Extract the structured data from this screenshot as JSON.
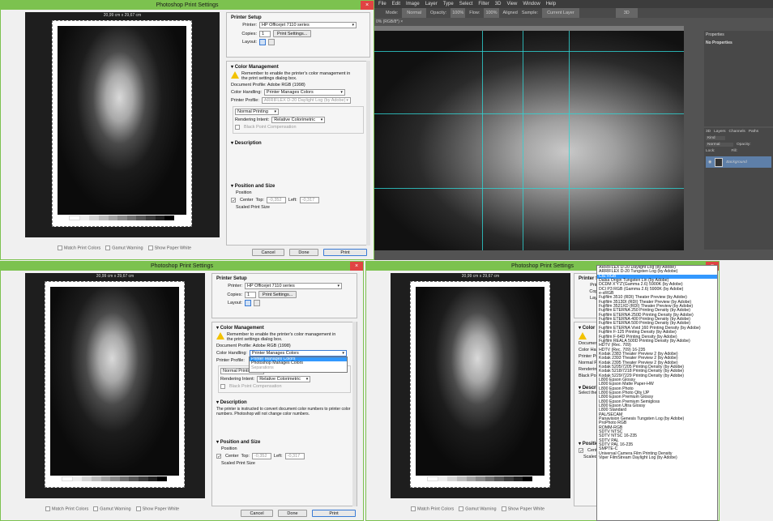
{
  "ps_app": {
    "logo": "Ps",
    "menu": [
      "File",
      "Edit",
      "Image",
      "Layer",
      "Type",
      "Select",
      "Filter",
      "3D",
      "View",
      "Window",
      "Help"
    ],
    "options": {
      "mode_label": "Mode:",
      "mode_value": "Normal",
      "opacity_label": "Opacity:",
      "opacity_value": "100%",
      "flow_label": "Flow:",
      "flow_value": "100%",
      "aligned_label": "Aligned",
      "sample_label": "Sample:",
      "sample_value": "Current Layer",
      "workspace": "3D"
    },
    "doc_tab": "0% (RGB/8*) ×",
    "properties_title": "Properties",
    "no_properties": "No Properties",
    "layer_tabs": [
      "3D",
      "Layers",
      "Channels",
      "Paths"
    ],
    "layer_kind": "Kind",
    "blend_mode": "Normal",
    "opacity_label": "Opacity:",
    "lock_label": "Lock:",
    "fill_label": "Fill:",
    "layer_name": "Background"
  },
  "dialog": {
    "title": "Photoshop Print Settings",
    "close": "×",
    "paper_size": "20,99 cm x 29,67 cm",
    "swatch_labels": [
      "0%",
      "10%",
      "20%",
      "30%",
      "40%",
      "50%",
      "60%",
      "70%",
      "80%",
      "90%",
      "100%"
    ],
    "match_print_colors": "Match Print Colors",
    "gamut_warning": "Gamut Warning",
    "show_paper_white": "Show Paper White",
    "printer_setup": "Printer Setup",
    "printer_label": "Printer:",
    "printer_value": "HP Officejet 7110 series",
    "copies_label": "Copies:",
    "copies_value": "1",
    "print_settings_btn": "Print Settings...",
    "layout_label": "Layout:",
    "color_management": "Color Management",
    "cm_note": "Remember to enable the printer's color management in the print settings dialog box.",
    "document_profile": "Document Profile: Adobe RGB (1998)",
    "color_handling_label": "Color Handling:",
    "color_handling_value": "Printer Manages Colors",
    "printer_profile_label": "Printer Profile:",
    "printer_profile_value": "ARRIFLEX D-20 Daylight Log (by Adobe)",
    "normal_printing": "Normal Printing",
    "rendering_intent_label": "Rendering Intent:",
    "rendering_intent_value": "Relative Colorimetric",
    "black_point": "Black Point Compensation",
    "description": "Description",
    "description_text": "The printer is instructed to convert document color numbers to printer color numbers. Photoshop will not change color numbers.",
    "description_text_short": "Select the profile a",
    "position_size": "Position and Size",
    "position": "Position",
    "center": "Center",
    "top_label": "Top:",
    "top_value": "-0,352",
    "left_label": "Left:",
    "left_value": "-0,317",
    "scaled_print_size": "Scaled Print Size",
    "cancel": "Cancel",
    "done": "Done",
    "print": "Print",
    "color_handling_options": [
      "Printer Manages Colors",
      "Photoshop Manages Colors",
      "Separations"
    ]
  },
  "profile_list": [
    "ARRIFLEX D-20 Daylight Log (by Adobe)",
    "ARRIFLEX D-20 Tungsten Log (by Adobe)",
    "CIE RGB",
    "Dalsa Origin Tungsten Lin (by Adobe)",
    "DCDM X'Y'Z'(Gamma 2.6) 5900K (by Adobe)",
    "DCI P3 RGB (Gamma 2.6) 5900K (by Adobe)",
    "e-sRGB",
    "Fujifilm 3510 (RDI) Theater Preview (by Adobe)",
    "Fujifilm 3513DI (RDI) Theater Preview (by Adobe)",
    "Fujifilm 3521XD (RDI) Theater Preview (by Adobe)",
    "Fujifilm ETERNA 250 Printing Density (by Adobe)",
    "Fujifilm ETERNA 250D Printing Density (by Adobe)",
    "Fujifilm ETERNA 400 Printing Density (by Adobe)",
    "Fujifilm ETERNA 500 Printing Density (by Adobe)",
    "Fujifilm ETERNA Vivid 160 Printing Density (by Adobe)",
    "Fujifilm F-125 Printing Density (by Adobe)",
    "Fujifilm F-64D Printing Density (by Adobe)",
    "Fujifilm REALA 500D Printing Density (by Adobe)",
    "HDTV (Rec. 709)",
    "HDTV (Rec. 709) 16-235",
    "Kodak 2383 Theater Preview 2 (by Adobe)",
    "Kodak 2393 Theater Preview 2 (by Adobe)",
    "Kodak 2395 Theater Preview 2 (by Adobe)",
    "Kodak 5205/7205 Printing Density (by Adobe)",
    "Kodak 5218/7218 Printing Density (by Adobe)",
    "Kodak 5229/7229 Printing Density (by Adobe)",
    "L800 Epson Glossy",
    "L800 Epson Matte Paper-HW",
    "L800 Epson Photo",
    "L800 Epson Photo Qlty IJP",
    "L800 Epson Premium Glossy",
    "L800 Epson Premium Semigloss",
    "L800 Epson Ultra Glossy",
    "L800 Standard",
    "PAL/SECAM",
    "Panavision Genesis Tungsten Log (by Adobe)",
    "ProPhoto RGB",
    "ROMM-RGB",
    "SDTV NTSC",
    "SDTV NTSC 16-235",
    "SDTV PAL",
    "SDTV PAL 16-235",
    "SMPTE-C",
    "Universal Camera Film Printing Density",
    "Viper FilmStream Daylight Log (by Adobe)"
  ],
  "colors": {
    "accent_green": "#7cc24f",
    "ps_dark": "#535353",
    "highlight": "#3399ff",
    "guide": "#2fd3d3"
  }
}
